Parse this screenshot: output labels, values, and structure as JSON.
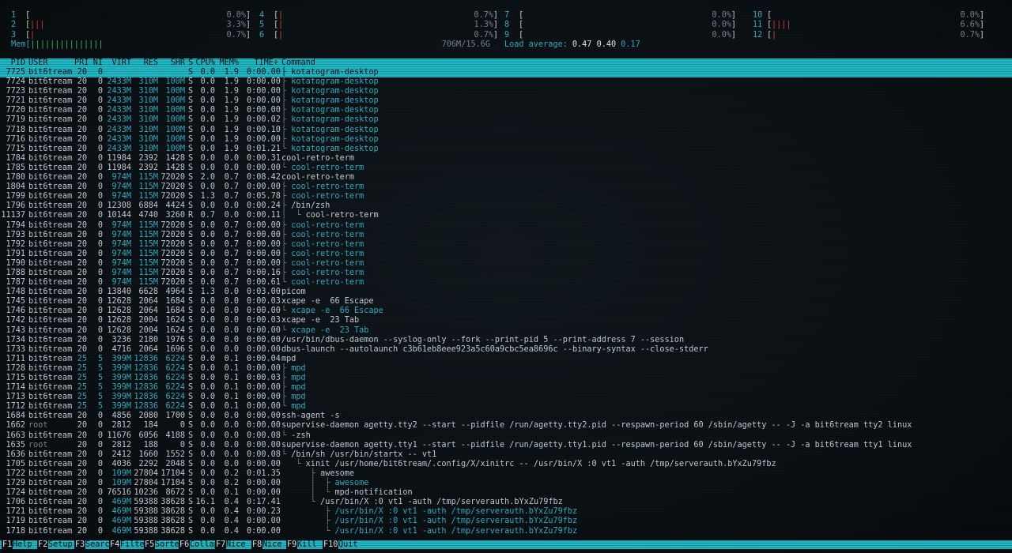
{
  "cpu_meters": [
    {
      "num": "1",
      "bar": "",
      "color": "red",
      "val": "0.0%"
    },
    {
      "num": "2",
      "bar": "|||",
      "color": "red",
      "val": "3.3%"
    },
    {
      "num": "3",
      "bar": "|",
      "color": "red",
      "val": "0.7%"
    },
    {
      "num": "4",
      "bar": "|",
      "color": "red",
      "val": "0.7%"
    },
    {
      "num": "5",
      "bar": "|",
      "color": "red",
      "val": "1.3%"
    },
    {
      "num": "6",
      "bar": "|",
      "color": "red",
      "val": "0.7%"
    },
    {
      "num": "7",
      "bar": "",
      "color": "red",
      "val": "0.0%"
    },
    {
      "num": "8",
      "bar": "",
      "color": "red",
      "val": "0.0%"
    },
    {
      "num": "9",
      "bar": "",
      "color": "red",
      "val": "0.0%"
    },
    {
      "num": "10",
      "bar": "",
      "color": "red",
      "val": "0.0%"
    },
    {
      "num": "11",
      "bar": "||||",
      "color": "red",
      "val": "6.6%"
    },
    {
      "num": "12",
      "bar": "|",
      "color": "red",
      "val": "0.7%"
    }
  ],
  "mem": {
    "label": "Mem",
    "bar": "|||||||||||||||",
    "value": "706M/15.6G"
  },
  "load": {
    "label": "Load average:",
    "l1": "0.47",
    "l2": "0.40",
    "l3": "0.17"
  },
  "header": {
    "pid": "PID",
    "user": "USER",
    "pri": "PRI",
    "ni": "NI",
    "virt": "VIRT",
    "res": "RES",
    "shr": "SHR",
    "s": "S",
    "cpu": "CPU%",
    "mem": "MEM%",
    "time": "TIME+",
    "cmd": "Command"
  },
  "processes": [
    {
      "pid": "7725",
      "user": "bit6tream",
      "pri": "20",
      "ni": "0",
      "virt": "2433M",
      "res": "310M",
      "shr": "100M",
      "s": "S",
      "cpu": "0.0",
      "mem": "1.9",
      "time": "0:00.00",
      "tree": "├ ",
      "cmd": "kotatogram-desktop",
      "thread": true,
      "sel": true
    },
    {
      "pid": "7724",
      "user": "bit6tream",
      "pri": "20",
      "ni": "0",
      "virt": "2433M",
      "res": "310M",
      "shr": "100M",
      "s": "S",
      "cpu": "0.0",
      "mem": "1.9",
      "time": "0:00.00",
      "tree": "├ ",
      "cmd": "kotatogram-desktop",
      "thread": true
    },
    {
      "pid": "7723",
      "user": "bit6tream",
      "pri": "20",
      "ni": "0",
      "virt": "2433M",
      "res": "310M",
      "shr": "100M",
      "s": "S",
      "cpu": "0.0",
      "mem": "1.9",
      "time": "0:00.00",
      "tree": "├ ",
      "cmd": "kotatogram-desktop",
      "thread": true
    },
    {
      "pid": "7721",
      "user": "bit6tream",
      "pri": "20",
      "ni": "0",
      "virt": "2433M",
      "res": "310M",
      "shr": "100M",
      "s": "S",
      "cpu": "0.0",
      "mem": "1.9",
      "time": "0:00.00",
      "tree": "├ ",
      "cmd": "kotatogram-desktop",
      "thread": true
    },
    {
      "pid": "7720",
      "user": "bit6tream",
      "pri": "20",
      "ni": "0",
      "virt": "2433M",
      "res": "310M",
      "shr": "100M",
      "s": "S",
      "cpu": "0.0",
      "mem": "1.9",
      "time": "0:00.00",
      "tree": "├ ",
      "cmd": "kotatogram-desktop",
      "thread": true
    },
    {
      "pid": "7719",
      "user": "bit6tream",
      "pri": "20",
      "ni": "0",
      "virt": "2433M",
      "res": "310M",
      "shr": "100M",
      "s": "S",
      "cpu": "0.0",
      "mem": "1.9",
      "time": "0:00.02",
      "tree": "├ ",
      "cmd": "kotatogram-desktop",
      "thread": true
    },
    {
      "pid": "7718",
      "user": "bit6tream",
      "pri": "20",
      "ni": "0",
      "virt": "2433M",
      "res": "310M",
      "shr": "100M",
      "s": "S",
      "cpu": "0.0",
      "mem": "1.9",
      "time": "0:00.10",
      "tree": "├ ",
      "cmd": "kotatogram-desktop",
      "thread": true
    },
    {
      "pid": "7716",
      "user": "bit6tream",
      "pri": "20",
      "ni": "0",
      "virt": "2433M",
      "res": "310M",
      "shr": "100M",
      "s": "S",
      "cpu": "0.0",
      "mem": "1.9",
      "time": "0:00.00",
      "tree": "├ ",
      "cmd": "kotatogram-desktop",
      "thread": true
    },
    {
      "pid": "7715",
      "user": "bit6tream",
      "pri": "20",
      "ni": "0",
      "virt": "2433M",
      "res": "310M",
      "shr": "100M",
      "s": "S",
      "cpu": "0.0",
      "mem": "1.9",
      "time": "0:01.21",
      "tree": "└ ",
      "cmd": "kotatogram-desktop",
      "thread": true
    },
    {
      "pid": "1784",
      "user": "bit6tream",
      "pri": "20",
      "ni": "0",
      "virt": "11984",
      "res": "2392",
      "shr": "1428",
      "s": "S",
      "cpu": "0.0",
      "mem": "0.0",
      "time": "0:00.31",
      "tree": "",
      "cmd": "cool-retro-term"
    },
    {
      "pid": "1785",
      "user": "bit6tream",
      "pri": "20",
      "ni": "0",
      "virt": "11984",
      "res": "2392",
      "shr": "1428",
      "s": "S",
      "cpu": "0.0",
      "mem": "0.0",
      "time": "0:00.00",
      "tree": "└ ",
      "cmd": "cool-retro-term",
      "thread": true
    },
    {
      "pid": "1780",
      "user": "bit6tream",
      "pri": "20",
      "ni": "0",
      "virt": "974M",
      "res": "115M",
      "shr": "72020",
      "s": "S",
      "cpu": "2.0",
      "mem": "0.7",
      "time": "0:08.42",
      "tree": "",
      "cmd": "cool-retro-term"
    },
    {
      "pid": "1804",
      "user": "bit6tream",
      "pri": "20",
      "ni": "0",
      "virt": "974M",
      "res": "115M",
      "shr": "72020",
      "s": "S",
      "cpu": "0.0",
      "mem": "0.7",
      "time": "0:00.00",
      "tree": "├ ",
      "cmd": "cool-retro-term",
      "thread": true
    },
    {
      "pid": "1799",
      "user": "bit6tream",
      "pri": "20",
      "ni": "0",
      "virt": "974M",
      "res": "115M",
      "shr": "72020",
      "s": "S",
      "cpu": "1.3",
      "mem": "0.7",
      "time": "0:05.78",
      "tree": "├ ",
      "cmd": "cool-retro-term",
      "thread": true
    },
    {
      "pid": "1796",
      "user": "bit6tream",
      "pri": "20",
      "ni": "0",
      "virt": "12308",
      "res": "6884",
      "shr": "4424",
      "s": "S",
      "cpu": "0.0",
      "mem": "0.0",
      "time": "0:00.24",
      "tree": "├ ",
      "cmd": "/bin/zsh"
    },
    {
      "pid": "11137",
      "user": "bit6tream",
      "pri": "20",
      "ni": "0",
      "virt": "10144",
      "res": "4740",
      "shr": "3260",
      "s": "R",
      "cpu": "0.7",
      "mem": "0.0",
      "time": "0:00.11",
      "tree": "│  └ ",
      "cmd": "cool-retro-term"
    },
    {
      "pid": "1794",
      "user": "bit6tream",
      "pri": "20",
      "ni": "0",
      "virt": "974M",
      "res": "115M",
      "shr": "72020",
      "s": "S",
      "cpu": "0.0",
      "mem": "0.7",
      "time": "0:00.00",
      "tree": "├ ",
      "cmd": "cool-retro-term",
      "thread": true
    },
    {
      "pid": "1793",
      "user": "bit6tream",
      "pri": "20",
      "ni": "0",
      "virt": "974M",
      "res": "115M",
      "shr": "72020",
      "s": "S",
      "cpu": "0.0",
      "mem": "0.7",
      "time": "0:00.00",
      "tree": "├ ",
      "cmd": "cool-retro-term",
      "thread": true
    },
    {
      "pid": "1792",
      "user": "bit6tream",
      "pri": "20",
      "ni": "0",
      "virt": "974M",
      "res": "115M",
      "shr": "72020",
      "s": "S",
      "cpu": "0.0",
      "mem": "0.7",
      "time": "0:00.00",
      "tree": "├ ",
      "cmd": "cool-retro-term",
      "thread": true
    },
    {
      "pid": "1791",
      "user": "bit6tream",
      "pri": "20",
      "ni": "0",
      "virt": "974M",
      "res": "115M",
      "shr": "72020",
      "s": "S",
      "cpu": "0.0",
      "mem": "0.7",
      "time": "0:00.00",
      "tree": "├ ",
      "cmd": "cool-retro-term",
      "thread": true
    },
    {
      "pid": "1790",
      "user": "bit6tream",
      "pri": "20",
      "ni": "0",
      "virt": "974M",
      "res": "115M",
      "shr": "72020",
      "s": "S",
      "cpu": "0.0",
      "mem": "0.7",
      "time": "0:00.00",
      "tree": "├ ",
      "cmd": "cool-retro-term",
      "thread": true
    },
    {
      "pid": "1788",
      "user": "bit6tream",
      "pri": "20",
      "ni": "0",
      "virt": "974M",
      "res": "115M",
      "shr": "72020",
      "s": "S",
      "cpu": "0.0",
      "mem": "0.7",
      "time": "0:00.16",
      "tree": "├ ",
      "cmd": "cool-retro-term",
      "thread": true
    },
    {
      "pid": "1787",
      "user": "bit6tream",
      "pri": "20",
      "ni": "0",
      "virt": "974M",
      "res": "115M",
      "shr": "72020",
      "s": "S",
      "cpu": "0.0",
      "mem": "0.7",
      "time": "0:00.61",
      "tree": "└ ",
      "cmd": "cool-retro-term",
      "thread": true
    },
    {
      "pid": "1748",
      "user": "bit6tream",
      "pri": "20",
      "ni": "0",
      "virt": "13840",
      "res": "6628",
      "shr": "4964",
      "s": "S",
      "cpu": "1.3",
      "mem": "0.0",
      "time": "0:03.00",
      "tree": "",
      "cmd": "picom"
    },
    {
      "pid": "1745",
      "user": "bit6tream",
      "pri": "20",
      "ni": "0",
      "virt": "12628",
      "res": "2064",
      "shr": "1684",
      "s": "S",
      "cpu": "0.0",
      "mem": "0.0",
      "time": "0:00.03",
      "tree": "",
      "cmd": "xcape -e  66 Escape"
    },
    {
      "pid": "1746",
      "user": "bit6tream",
      "pri": "20",
      "ni": "0",
      "virt": "12628",
      "res": "2064",
      "shr": "1684",
      "s": "S",
      "cpu": "0.0",
      "mem": "0.0",
      "time": "0:00.00",
      "tree": "└ ",
      "cmd": "xcape -e  66 Escape",
      "thread": true
    },
    {
      "pid": "1742",
      "user": "bit6tream",
      "pri": "20",
      "ni": "0",
      "virt": "12628",
      "res": "2004",
      "shr": "1624",
      "s": "S",
      "cpu": "0.0",
      "mem": "0.0",
      "time": "0:00.03",
      "tree": "",
      "cmd": "xcape -e  23 Tab"
    },
    {
      "pid": "1743",
      "user": "bit6tream",
      "pri": "20",
      "ni": "0",
      "virt": "12628",
      "res": "2004",
      "shr": "1624",
      "s": "S",
      "cpu": "0.0",
      "mem": "0.0",
      "time": "0:00.00",
      "tree": "└ ",
      "cmd": "xcape -e  23 Tab",
      "thread": true
    },
    {
      "pid": "1734",
      "user": "bit6tream",
      "pri": "20",
      "ni": "0",
      "virt": "3236",
      "res": "2180",
      "shr": "1976",
      "s": "S",
      "cpu": "0.0",
      "mem": "0.0",
      "time": "0:00.00",
      "tree": "",
      "cmd": "/usr/bin/dbus-daemon --syslog-only --fork --print-pid 5 --print-address 7 --session"
    },
    {
      "pid": "1733",
      "user": "bit6tream",
      "pri": "20",
      "ni": "0",
      "virt": "4716",
      "res": "2064",
      "shr": "1696",
      "s": "S",
      "cpu": "0.0",
      "mem": "0.0",
      "time": "0:00.00",
      "tree": "",
      "cmd": "dbus-launch --autolaunch c3b61eb8eee923a5c60a9cbc5ea8696c --binary-syntax --close-stderr"
    },
    {
      "pid": "1711",
      "user": "bit6tream",
      "pri": "25",
      "ni": "5",
      "virt": "399M",
      "res": "12836",
      "shr": "6224",
      "s": "S",
      "cpu": "0.0",
      "mem": "0.1",
      "time": "0:00.04",
      "tree": "",
      "cmd": "mpd"
    },
    {
      "pid": "1728",
      "user": "bit6tream",
      "pri": "25",
      "ni": "5",
      "virt": "399M",
      "res": "12836",
      "shr": "6224",
      "s": "S",
      "cpu": "0.0",
      "mem": "0.1",
      "time": "0:00.00",
      "tree": "├ ",
      "cmd": "mpd",
      "thread": true
    },
    {
      "pid": "1715",
      "user": "bit6tream",
      "pri": "25",
      "ni": "5",
      "virt": "399M",
      "res": "12836",
      "shr": "6224",
      "s": "S",
      "cpu": "0.0",
      "mem": "0.1",
      "time": "0:00.03",
      "tree": "├ ",
      "cmd": "mpd",
      "thread": true
    },
    {
      "pid": "1714",
      "user": "bit6tream",
      "pri": "25",
      "ni": "5",
      "virt": "399M",
      "res": "12836",
      "shr": "6224",
      "s": "S",
      "cpu": "0.0",
      "mem": "0.1",
      "time": "0:00.00",
      "tree": "├ ",
      "cmd": "mpd",
      "thread": true
    },
    {
      "pid": "1713",
      "user": "bit6tream",
      "pri": "25",
      "ni": "5",
      "virt": "399M",
      "res": "12836",
      "shr": "6224",
      "s": "S",
      "cpu": "0.0",
      "mem": "0.1",
      "time": "0:00.00",
      "tree": "├ ",
      "cmd": "mpd",
      "thread": true
    },
    {
      "pid": "1712",
      "user": "bit6tream",
      "pri": "25",
      "ni": "5",
      "virt": "399M",
      "res": "12836",
      "shr": "6224",
      "s": "S",
      "cpu": "0.0",
      "mem": "0.1",
      "time": "0:00.00",
      "tree": "└ ",
      "cmd": "mpd",
      "thread": true
    },
    {
      "pid": "1684",
      "user": "bit6tream",
      "pri": "20",
      "ni": "0",
      "virt": "4856",
      "res": "2080",
      "shr": "1700",
      "s": "S",
      "cpu": "0.0",
      "mem": "0.0",
      "time": "0:00.00",
      "tree": "",
      "cmd": "ssh-agent -s"
    },
    {
      "pid": "1662",
      "user": "root",
      "pri": "20",
      "ni": "0",
      "virt": "2812",
      "res": "184",
      "shr": "0",
      "s": "S",
      "cpu": "0.0",
      "mem": "0.0",
      "time": "0:00.00",
      "tree": "",
      "cmd": "supervise-daemon agetty.tty2 --start --pidfile /run/agetty.tty2.pid --respawn-period 60 /sbin/agetty -- -J -a bit6tream tty2 linux"
    },
    {
      "pid": "1663",
      "user": "bit6tream",
      "pri": "20",
      "ni": "0",
      "virt": "11676",
      "res": "6056",
      "shr": "4188",
      "s": "S",
      "cpu": "0.0",
      "mem": "0.0",
      "time": "0:00.08",
      "tree": "└ ",
      "cmd": "-zsh"
    },
    {
      "pid": "1635",
      "user": "root",
      "pri": "20",
      "ni": "0",
      "virt": "2812",
      "res": "188",
      "shr": "0",
      "s": "S",
      "cpu": "0.0",
      "mem": "0.0",
      "time": "0:00.00",
      "tree": "",
      "cmd": "supervise-daemon agetty.tty1 --start --pidfile /run/agetty.tty1.pid --respawn-period 60 /sbin/agetty -- -J -a bit6tream tty1 linux"
    },
    {
      "pid": "1636",
      "user": "bit6tream",
      "pri": "20",
      "ni": "0",
      "virt": "2412",
      "res": "1660",
      "shr": "1552",
      "s": "S",
      "cpu": "0.0",
      "mem": "0.0",
      "time": "0:00.08",
      "tree": "└ ",
      "cmd": "/bin/sh /usr/bin/startx -- vt1"
    },
    {
      "pid": "1705",
      "user": "bit6tream",
      "pri": "20",
      "ni": "0",
      "virt": "4036",
      "res": "2292",
      "shr": "2048",
      "s": "S",
      "cpu": "0.0",
      "mem": "0.0",
      "time": "0:00.00",
      "tree": "   └ ",
      "cmd": "xinit /usr/home/bit6tream/.config/X/xinitrc -- /usr/bin/X :0 vt1 -auth /tmp/serverauth.bYxZu79fbz"
    },
    {
      "pid": "1722",
      "user": "bit6tream",
      "pri": "20",
      "ni": "0",
      "virt": "109M",
      "res": "27804",
      "shr": "17104",
      "s": "S",
      "cpu": "0.0",
      "mem": "0.2",
      "time": "0:01.35",
      "tree": "      ├ ",
      "cmd": "awesome"
    },
    {
      "pid": "1729",
      "user": "bit6tream",
      "pri": "20",
      "ni": "0",
      "virt": "109M",
      "res": "27804",
      "shr": "17104",
      "s": "S",
      "cpu": "0.0",
      "mem": "0.2",
      "time": "0:00.00",
      "tree": "      │  ├ ",
      "cmd": "awesome",
      "thread": true
    },
    {
      "pid": "1724",
      "user": "bit6tream",
      "pri": "20",
      "ni": "0",
      "virt": "76516",
      "res": "10236",
      "shr": "8672",
      "s": "S",
      "cpu": "0.0",
      "mem": "0.1",
      "time": "0:00.00",
      "tree": "      │  └ ",
      "cmd": "mpd-notification"
    },
    {
      "pid": "1706",
      "user": "bit6tream",
      "pri": "20",
      "ni": "0",
      "virt": "469M",
      "res": "59388",
      "shr": "38628",
      "s": "S",
      "cpu": "16.1",
      "mem": "0.4",
      "time": "0:17.41",
      "tree": "      └ ",
      "cmd": "/usr/bin/X :0 vt1 -auth /tmp/serverauth.bYxZu79fbz"
    },
    {
      "pid": "1721",
      "user": "bit6tream",
      "pri": "20",
      "ni": "0",
      "virt": "469M",
      "res": "59388",
      "shr": "38628",
      "s": "S",
      "cpu": "0.0",
      "mem": "0.4",
      "time": "0:00.23",
      "tree": "         ├ ",
      "cmd": "/usr/bin/X :0 vt1 -auth /tmp/serverauth.bYxZu79fbz",
      "thread": true
    },
    {
      "pid": "1719",
      "user": "bit6tream",
      "pri": "20",
      "ni": "0",
      "virt": "469M",
      "res": "59388",
      "shr": "38628",
      "s": "S",
      "cpu": "0.0",
      "mem": "0.4",
      "time": "0:00.00",
      "tree": "         ├ ",
      "cmd": "/usr/bin/X :0 vt1 -auth /tmp/serverauth.bYxZu79fbz",
      "thread": true
    },
    {
      "pid": "1718",
      "user": "bit6tream",
      "pri": "20",
      "ni": "0",
      "virt": "469M",
      "res": "59388",
      "shr": "38628",
      "s": "S",
      "cpu": "0.0",
      "mem": "0.4",
      "time": "0:00.00",
      "tree": "         └ ",
      "cmd": "/usr/bin/X :0 vt1 -auth /tmp/serverauth.bYxZu79fbz",
      "thread": true
    }
  ],
  "footer": [
    {
      "key": "F1",
      "label": "Help"
    },
    {
      "key": "F2",
      "label": "Setup"
    },
    {
      "key": "F3",
      "label": "Search"
    },
    {
      "key": "F4",
      "label": "Filter"
    },
    {
      "key": "F5",
      "label": "Sorted"
    },
    {
      "key": "F6",
      "label": "Collap"
    },
    {
      "key": "F7",
      "label": "Nice -"
    },
    {
      "key": "F8",
      "label": "Nice +"
    },
    {
      "key": "F9",
      "label": "Kill"
    },
    {
      "key": "F10",
      "label": "Quit"
    }
  ]
}
